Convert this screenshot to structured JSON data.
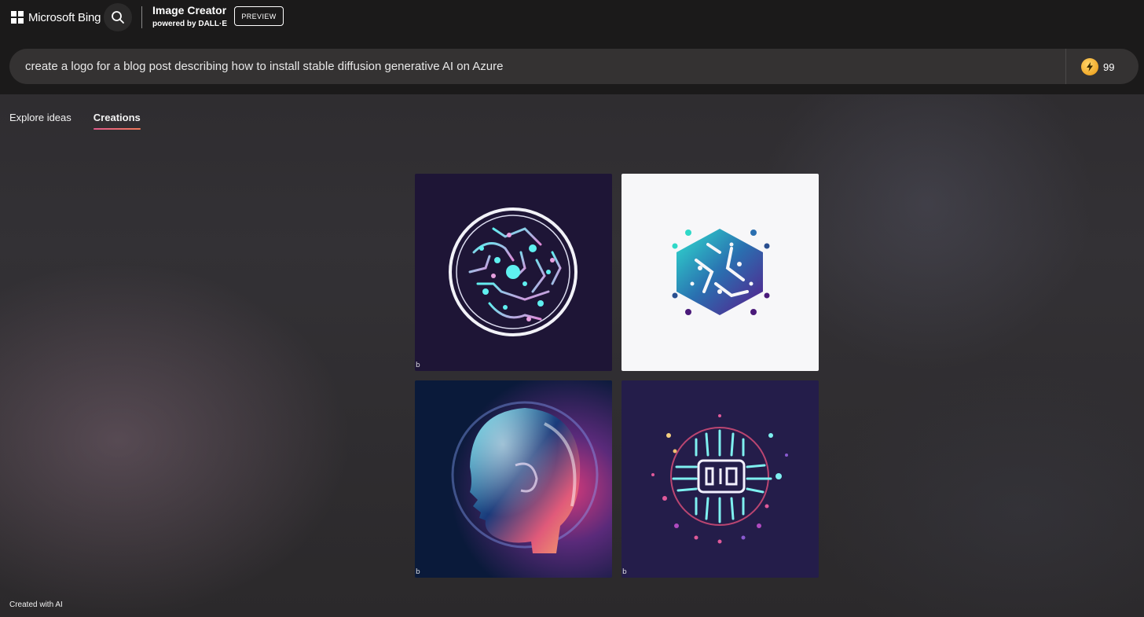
{
  "header": {
    "brand": "Microsoft Bing",
    "app_title": "Image Creator",
    "app_subtitle": "powered by DALL·E",
    "preview_label": "PREVIEW"
  },
  "prompt": {
    "value": "create a logo for a blog post describing how to install stable diffusion generative AI on Azure",
    "boosts": "99"
  },
  "tabs": [
    {
      "label": "Explore ideas",
      "active": false
    },
    {
      "label": "Creations",
      "active": true
    }
  ],
  "images": [
    {
      "name": "circuit-circle-logo",
      "watermark": "b"
    },
    {
      "name": "hexagon-chip-logo",
      "watermark": ""
    },
    {
      "name": "glass-head-profile",
      "watermark": "b"
    },
    {
      "name": "chip-burst-logo",
      "watermark": "b"
    }
  ],
  "footer": {
    "note": "Created with AI"
  },
  "colors": {
    "header_bg": "#1b1a1a",
    "prompt_bg": "#343232",
    "tab_underline": "#e05a8a",
    "coin": "#f0a92a"
  }
}
